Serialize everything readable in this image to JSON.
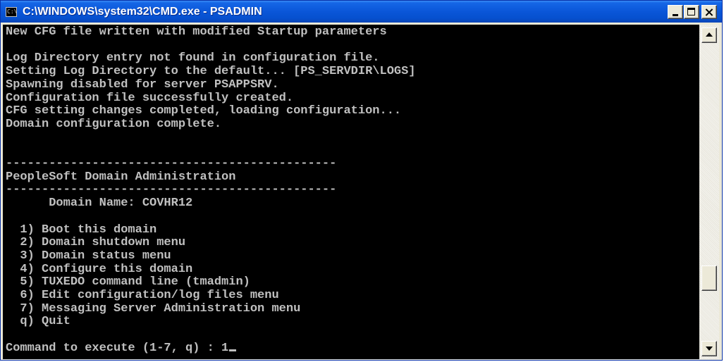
{
  "window": {
    "title": "C:\\WINDOWS\\system32\\CMD.exe - PSADMIN",
    "icon_name": "cmd-console-icon",
    "icon_text": "C:\\"
  },
  "console": {
    "lines": [
      "New CFG file written with modified Startup parameters",
      "",
      "Log Directory entry not found in configuration file.",
      "Setting Log Directory to the default... [PS_SERVDIR\\LOGS]",
      "Spawning disabled for server PSAPPSRV.",
      "Configuration file successfully created.",
      "CFG setting changes completed, loading configuration...",
      "Domain configuration complete.",
      "",
      "",
      "----------------------------------------------",
      "PeopleSoft Domain Administration",
      "----------------------------------------------",
      "      Domain Name: COVHR12",
      "",
      "  1) Boot this domain",
      "  2) Domain shutdown menu",
      "  3) Domain status menu",
      "  4) Configure this domain",
      "  5) TUXEDO command line (tmadmin)",
      "  6) Edit configuration/log files menu",
      "  7) Messaging Server Administration menu",
      "  q) Quit",
      ""
    ],
    "prompt": "Command to execute (1-7, q) : 1",
    "text_color": "#c0c0c0",
    "background_color": "#000000"
  },
  "scrollbar": {
    "position_fraction": 0.82
  }
}
